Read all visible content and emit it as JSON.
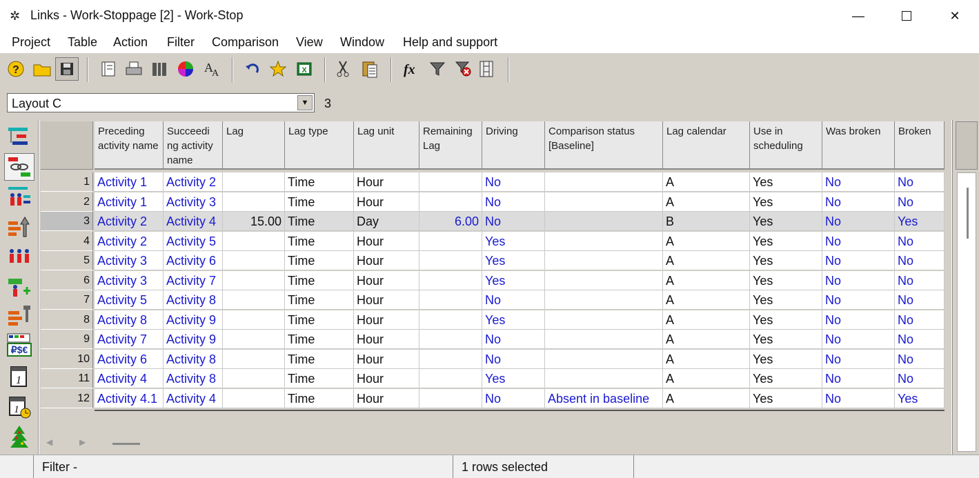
{
  "window": {
    "title": "Links - Work-Stoppage [2] - Work-Stop",
    "minimize": "—",
    "close": "✕"
  },
  "menu": [
    "Project",
    "Table",
    "Action",
    "Filter",
    "Comparison",
    "View",
    "Window",
    "Help and support"
  ],
  "toolbar": {
    "icons": [
      "help-icon",
      "open-folder-icon",
      "save-icon",
      "notebook-icon",
      "print-icon",
      "tools-icon",
      "color-wheel-icon",
      "font-icon",
      "undo-icon",
      "star-icon",
      "excel-icon",
      "cut-icon",
      "paste-icon",
      "formula-icon",
      "filter-icon",
      "clear-filter-icon",
      "film-icon"
    ]
  },
  "layout": {
    "selected": "Layout C",
    "count": "3"
  },
  "columns": [
    "Preceding activity name",
    "Succeedi ng activity name",
    "Lag",
    "Lag type",
    "Lag unit",
    "Remaining Lag",
    "Driving",
    "Comparison status [Baseline]",
    "Lag calendar",
    "Use in scheduling",
    "Was broken",
    "Broken"
  ],
  "rows": [
    {
      "n": "1",
      "pre": "Activity 1",
      "suc": "Activity 2",
      "lag": "",
      "lagtype": "Time",
      "unit": "Hour",
      "rem": "",
      "driving": "No",
      "cmp": "",
      "cal": "A",
      "use": "Yes",
      "was": "No",
      "broken": "No"
    },
    {
      "n": "2",
      "pre": "Activity 1",
      "suc": "Activity 3",
      "lag": "",
      "lagtype": "Time",
      "unit": "Hour",
      "rem": "",
      "driving": "No",
      "cmp": "",
      "cal": "A",
      "use": "Yes",
      "was": "No",
      "broken": "No"
    },
    {
      "n": "3",
      "pre": "Activity 2",
      "suc": "Activity 4",
      "lag": "15.00",
      "lagtype": "Time",
      "unit": "Day",
      "rem": "6.00",
      "driving": "No",
      "cmp": "",
      "cal": "B",
      "use": "Yes",
      "was": "No",
      "broken": "Yes"
    },
    {
      "n": "4",
      "pre": "Activity 2",
      "suc": "Activity 5",
      "lag": "",
      "lagtype": "Time",
      "unit": "Hour",
      "rem": "",
      "driving": "Yes",
      "cmp": "",
      "cal": "A",
      "use": "Yes",
      "was": "No",
      "broken": "No"
    },
    {
      "n": "5",
      "pre": "Activity 3",
      "suc": "Activity 6",
      "lag": "",
      "lagtype": "Time",
      "unit": "Hour",
      "rem": "",
      "driving": "Yes",
      "cmp": "",
      "cal": "A",
      "use": "Yes",
      "was": "No",
      "broken": "No"
    },
    {
      "n": "6",
      "pre": "Activity 3",
      "suc": "Activity 7",
      "lag": "",
      "lagtype": "Time",
      "unit": "Hour",
      "rem": "",
      "driving": "Yes",
      "cmp": "",
      "cal": "A",
      "use": "Yes",
      "was": "No",
      "broken": "No"
    },
    {
      "n": "7",
      "pre": "Activity 5",
      "suc": "Activity 8",
      "lag": "",
      "lagtype": "Time",
      "unit": "Hour",
      "rem": "",
      "driving": "No",
      "cmp": "",
      "cal": "A",
      "use": "Yes",
      "was": "No",
      "broken": "No"
    },
    {
      "n": "8",
      "pre": "Activity 8",
      "suc": "Activity 9",
      "lag": "",
      "lagtype": "Time",
      "unit": "Hour",
      "rem": "",
      "driving": "Yes",
      "cmp": "",
      "cal": "A",
      "use": "Yes",
      "was": "No",
      "broken": "No"
    },
    {
      "n": "9",
      "pre": "Activity 7",
      "suc": "Activity 9",
      "lag": "",
      "lagtype": "Time",
      "unit": "Hour",
      "rem": "",
      "driving": "No",
      "cmp": "",
      "cal": "A",
      "use": "Yes",
      "was": "No",
      "broken": "No"
    },
    {
      "n": "10",
      "pre": "Activity 6",
      "suc": "Activity 8",
      "lag": "",
      "lagtype": "Time",
      "unit": "Hour",
      "rem": "",
      "driving": "No",
      "cmp": "",
      "cal": "A",
      "use": "Yes",
      "was": "No",
      "broken": "No"
    },
    {
      "n": "11",
      "pre": "Activity 4",
      "suc": "Activity 8",
      "lag": "",
      "lagtype": "Time",
      "unit": "Hour",
      "rem": "",
      "driving": "Yes",
      "cmp": "",
      "cal": "A",
      "use": "Yes",
      "was": "No",
      "broken": "No"
    },
    {
      "n": "12",
      "pre": "Activity 4.1",
      "suc": "Activity 4",
      "lag": "",
      "lagtype": "Time",
      "unit": "Hour",
      "rem": "",
      "driving": "No",
      "cmp": "Absent in baseline",
      "cal": "A",
      "use": "Yes",
      "was": "No",
      "broken": "Yes"
    }
  ],
  "selected_row": "3",
  "status": {
    "filter": "Filter -",
    "selection": "1 rows selected"
  },
  "colors": {
    "link_text": "#1a1ad0",
    "panel": "#d4d0c8"
  }
}
